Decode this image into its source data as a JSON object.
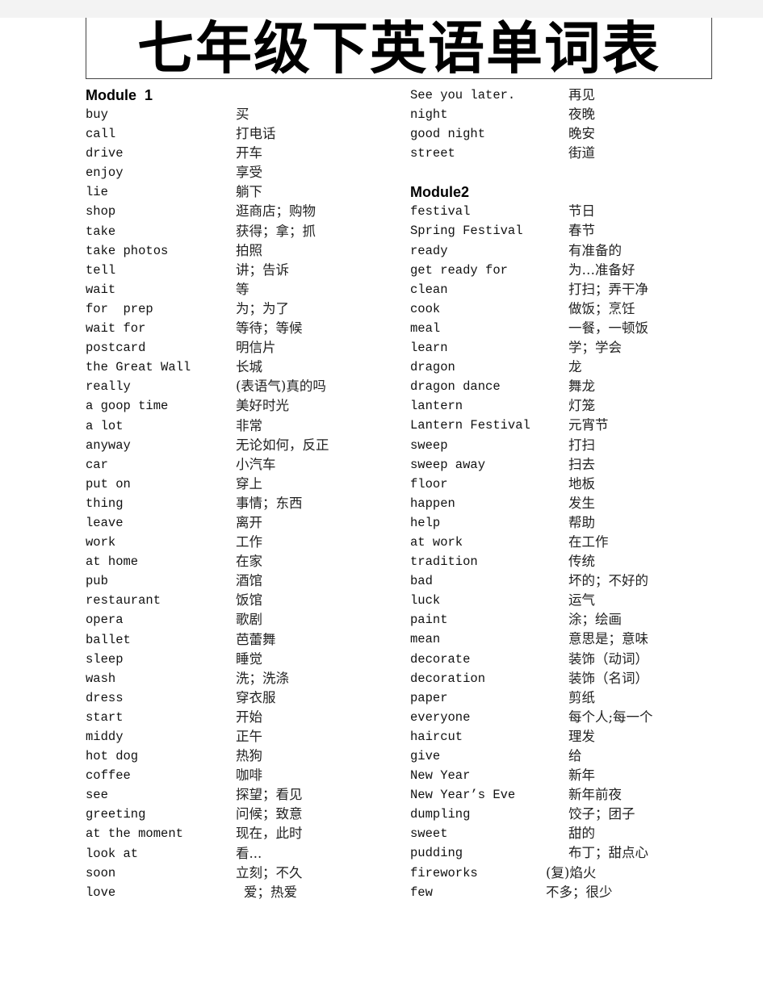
{
  "document": {
    "title": "七年级下英语单词表"
  },
  "left_column": {
    "module_heading": "Module  1",
    "entries": [
      {
        "en": "buy",
        "zh": "买"
      },
      {
        "en": "call",
        "zh": "打电话"
      },
      {
        "en": "drive",
        "zh": "开车"
      },
      {
        "en": "enjoy",
        "zh": "享受"
      },
      {
        "en": "lie",
        "zh": "躺下"
      },
      {
        "en": "shop",
        "zh": "逛商店；购物"
      },
      {
        "en": "take",
        "zh": "获得；拿；抓"
      },
      {
        "en": "take photos",
        "zh": "拍照"
      },
      {
        "en": "tell",
        "zh": "讲；告诉"
      },
      {
        "en": "wait",
        "zh": "等"
      },
      {
        "en": "for  prep",
        "zh": "为；为了"
      },
      {
        "en": "wait for",
        "zh": "等待；等候"
      },
      {
        "en": "postcard",
        "zh": "明信片"
      },
      {
        "en": "the Great Wall",
        "zh": "长城"
      },
      {
        "en": "really",
        "zh": "(表语气)真的吗"
      },
      {
        "en": "a goop time",
        "zh": "美好时光"
      },
      {
        "en": "a lot",
        "zh": "非常"
      },
      {
        "en": "anyway",
        "zh": "无论如何，反正"
      },
      {
        "en": "car",
        "zh": "小汽车"
      },
      {
        "en": "put on",
        "zh": "穿上"
      },
      {
        "en": "thing",
        "zh": "事情；东西"
      },
      {
        "en": "leave",
        "zh": "离开"
      },
      {
        "en": "work",
        "zh": "工作"
      },
      {
        "en": "at home",
        "zh": "在家"
      },
      {
        "en": "pub",
        "zh": "酒馆"
      },
      {
        "en": "restaurant",
        "zh": "饭馆"
      },
      {
        "en": "opera",
        "zh": "歌剧"
      },
      {
        "en": "ballet",
        "zh": "芭蕾舞"
      },
      {
        "en": "sleep",
        "zh": "睡觉"
      },
      {
        "en": "wash",
        "zh": "洗；洗涤"
      },
      {
        "en": "dress",
        "zh": "穿衣服"
      },
      {
        "en": "start",
        "zh": "开始"
      },
      {
        "en": "middy",
        "zh": "正午"
      },
      {
        "en": "hot dog",
        "zh": "热狗"
      },
      {
        "en": "coffee",
        "zh": "咖啡"
      },
      {
        "en": "see",
        "zh": "探望；看见"
      },
      {
        "en": "greeting",
        "zh": "问候；致意"
      },
      {
        "en": "at the moment",
        "zh": "现在，此时"
      },
      {
        "en": "look at",
        "zh": "看..."
      },
      {
        "en": "soon",
        "zh": "立刻；不久"
      },
      {
        "en": "love",
        "zh": "爱；热爱"
      }
    ]
  },
  "right_column": {
    "module1_continued": [
      {
        "en": "See you later.",
        "zh": "再见"
      },
      {
        "en": "night",
        "zh": "夜晚"
      },
      {
        "en": "good night",
        "zh": "晚安"
      },
      {
        "en": "street",
        "zh": "街道"
      }
    ],
    "module_heading": "Module2",
    "entries": [
      {
        "en": "festival",
        "zh": "节日"
      },
      {
        "en": "Spring Festival",
        "zh": "春节"
      },
      {
        "en": "ready",
        "zh": "有准备的"
      },
      {
        "en": "get ready for",
        "zh": "为…准备好"
      },
      {
        "en": "clean",
        "zh": "打扫；弄干净"
      },
      {
        "en": "cook",
        "zh": "做饭；烹饪"
      },
      {
        "en": "meal",
        "zh": "一餐，一顿饭"
      },
      {
        "en": "learn",
        "zh": "学；学会"
      },
      {
        "en": "dragon",
        "zh": "龙"
      },
      {
        "en": "dragon dance",
        "zh": "舞龙"
      },
      {
        "en": "lantern",
        "zh": "灯笼"
      },
      {
        "en": "Lantern Festival",
        "zh": "元宵节"
      },
      {
        "en": "sweep",
        "zh": "打扫"
      },
      {
        "en": "sweep away",
        "zh": "扫去"
      },
      {
        "en": "floor",
        "zh": "地板"
      },
      {
        "en": "happen",
        "zh": "发生"
      },
      {
        "en": "help",
        "zh": "帮助"
      },
      {
        "en": "at work",
        "zh": "在工作"
      },
      {
        "en": "tradition",
        "zh": "传统"
      },
      {
        "en": "bad",
        "zh": "坏的；不好的"
      },
      {
        "en": "luck",
        "zh": "运气"
      },
      {
        "en": "paint",
        "zh": "涂；绘画"
      },
      {
        "en": "mean",
        "zh": "意思是；意味"
      },
      {
        "en": "decorate",
        "zh": "装饰（动词）"
      },
      {
        "en": "decoration",
        "zh": "装饰（名词）"
      },
      {
        "en": "paper",
        "zh": "剪纸"
      },
      {
        "en": "everyone",
        "zh": "每个人;每一个"
      },
      {
        "en": "haircut",
        "zh": "理发"
      },
      {
        "en": "give",
        "zh": "给"
      },
      {
        "en": "New Year",
        "zh": "新年"
      },
      {
        "en": "New Year’s Eve",
        "zh": "新年前夜"
      },
      {
        "en": "dumpling",
        "zh": "饺子；团子"
      },
      {
        "en": "sweet",
        "zh": "甜的"
      },
      {
        "en": "pudding",
        "zh": "布丁；甜点心"
      },
      {
        "en": "fireworks",
        "zh": "(复)焰火"
      },
      {
        "en": "few",
        "zh": "不多；很少"
      }
    ]
  }
}
